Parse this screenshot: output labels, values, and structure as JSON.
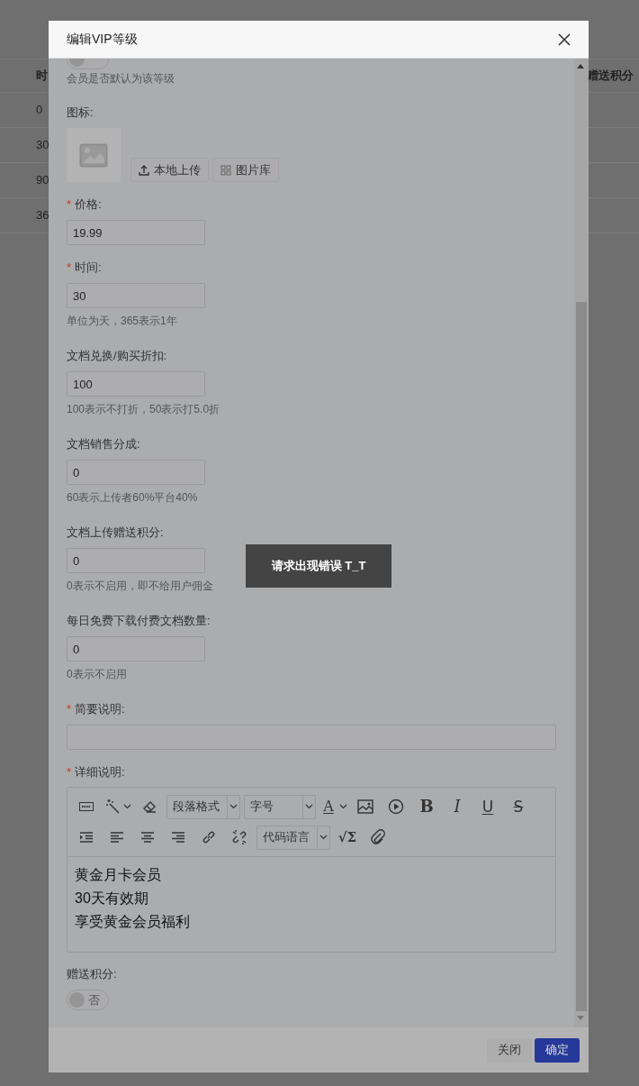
{
  "background_table": {
    "columns": [
      "时",
      "赠送积分"
    ],
    "rows": [
      [
        "0"
      ],
      [
        "30"
      ],
      [
        "90"
      ],
      [
        "36"
      ]
    ]
  },
  "dialog": {
    "title": "编辑VIP等级",
    "default_level": {
      "on": false,
      "hint": "会员是否默认为该等级"
    },
    "icon": {
      "label": "图标:",
      "buttons": [
        {
          "kind": "upload",
          "label": "本地上传"
        },
        {
          "kind": "gallery",
          "label": "图片库"
        }
      ]
    },
    "fields": [
      {
        "label": "价格:",
        "required_mark": "*",
        "value": "19.99"
      },
      {
        "label": "时间:",
        "required_mark": "*",
        "value": "30",
        "hint": "单位为天，365表示1年"
      },
      {
        "label": "文档兑换/购买折扣:",
        "value": "100",
        "hint": "100表示不打折，50表示打5.0折"
      },
      {
        "label": "文档销售分成:",
        "value": "0",
        "hint": "60表示上传者60%平台40%"
      },
      {
        "label": "文档上传赠送积分:",
        "value": "0",
        "hint": "0表示不启用，即不给用户佣金"
      },
      {
        "label": "每日免费下载付费文档数量:",
        "value": "0",
        "hint": "0表示不启用"
      },
      {
        "label": "简要说明:",
        "required_mark": "*",
        "wide": true
      }
    ],
    "editor": {
      "label": "详细说明:",
      "required_mark": "*",
      "toolbar": [
        [
          {
            "kind": "html"
          },
          {
            "kind": "magic",
            "caret": true
          },
          {
            "kind": "eraser"
          },
          {
            "kind": "select",
            "label": "段落格式"
          },
          {
            "kind": "select",
            "label": "字号"
          },
          {
            "kind": "color",
            "text": "A",
            "caret": true
          },
          {
            "kind": "image"
          },
          {
            "kind": "video"
          },
          {
            "kind": "bold",
            "text": "B"
          },
          {
            "kind": "italic",
            "text": "I"
          },
          {
            "kind": "underline",
            "text": "U"
          },
          {
            "kind": "strike",
            "text": "S"
          }
        ],
        [
          {
            "kind": "indent"
          },
          {
            "kind": "align-left"
          },
          {
            "kind": "align-center"
          },
          {
            "kind": "align-right"
          },
          {
            "kind": "link"
          },
          {
            "kind": "unlink"
          },
          {
            "kind": "select",
            "label": "代码语言"
          },
          {
            "kind": "formula",
            "text": "√Σ"
          },
          {
            "kind": "attach"
          }
        ]
      ],
      "lines": [
        "黄金月卡会员",
        "30天有效期",
        "享受黄金会员福利"
      ]
    },
    "gift": {
      "label": "赠送积分:",
      "on": false,
      "text": "否"
    },
    "buttons": [
      {
        "kind": "secondary",
        "label": "关闭"
      },
      {
        "kind": "primary",
        "label": "确定"
      }
    ]
  },
  "toast": "请求出现错误 T_T"
}
